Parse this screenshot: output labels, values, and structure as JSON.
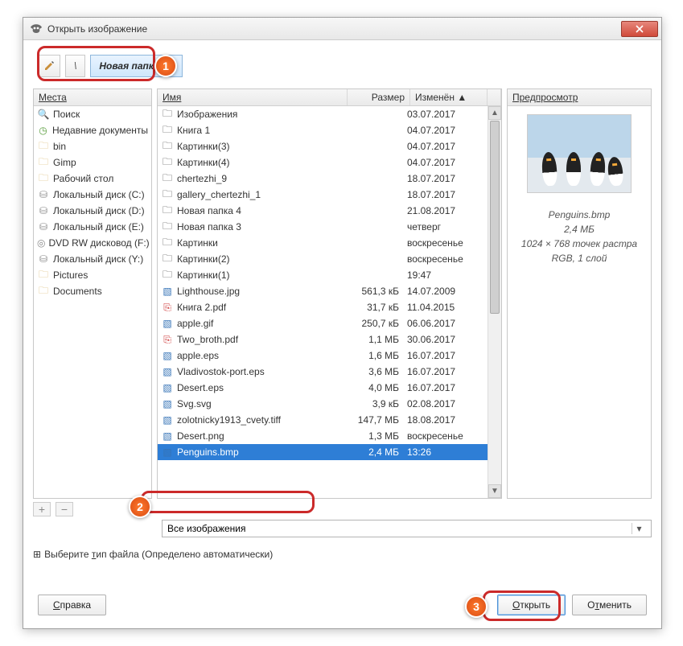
{
  "window": {
    "title": "Открыть изображение"
  },
  "path": {
    "root_label": "\\",
    "folder_label": "Новая папка (2)"
  },
  "places": {
    "header": "Места",
    "items": [
      {
        "label": "Поиск",
        "icon": "search-icon"
      },
      {
        "label": "Недавние документы",
        "icon": "clock-icon"
      },
      {
        "label": "bin",
        "icon": "folder-icon"
      },
      {
        "label": "Gimp",
        "icon": "folder-icon"
      },
      {
        "label": "Рабочий стол",
        "icon": "folder-icon"
      },
      {
        "label": "Локальный диск (C:)",
        "icon": "drive-icon"
      },
      {
        "label": "Локальный диск (D:)",
        "icon": "drive-icon"
      },
      {
        "label": "Локальный диск (E:)",
        "icon": "drive-icon"
      },
      {
        "label": "DVD RW дисковод (F:)",
        "icon": "dvd-icon"
      },
      {
        "label": "Локальный диск (Y:)",
        "icon": "drive-icon"
      },
      {
        "label": "Pictures",
        "icon": "folder-icon"
      },
      {
        "label": "Documents",
        "icon": "folder-icon"
      }
    ]
  },
  "files": {
    "header_name": "Имя",
    "header_size": "Размер",
    "header_modified": "Изменён",
    "rows": [
      {
        "name": "Изображения",
        "size": "",
        "mod": "03.07.2017",
        "icon": "folder"
      },
      {
        "name": "Книга 1",
        "size": "",
        "mod": "04.07.2017",
        "icon": "folder"
      },
      {
        "name": "Картинки(3)",
        "size": "",
        "mod": "04.07.2017",
        "icon": "folder"
      },
      {
        "name": "Картинки(4)",
        "size": "",
        "mod": "04.07.2017",
        "icon": "folder"
      },
      {
        "name": "chertezhi_9",
        "size": "",
        "mod": "18.07.2017",
        "icon": "folder"
      },
      {
        "name": "gallery_chertezhi_1",
        "size": "",
        "mod": "18.07.2017",
        "icon": "folder"
      },
      {
        "name": "Новая папка 4",
        "size": "",
        "mod": "21.08.2017",
        "icon": "folder"
      },
      {
        "name": "Новая папка 3",
        "size": "",
        "mod": "четверг",
        "icon": "folder"
      },
      {
        "name": "Картинки",
        "size": "",
        "mod": "воскресенье",
        "icon": "folder"
      },
      {
        "name": "Картинки(2)",
        "size": "",
        "mod": "воскресенье",
        "icon": "folder"
      },
      {
        "name": "Картинки(1)",
        "size": "",
        "mod": "19:47",
        "icon": "folder"
      },
      {
        "name": "Lighthouse.jpg",
        "size": "561,3 кБ",
        "mod": "14.07.2009",
        "icon": "jpg"
      },
      {
        "name": "Книга 2.pdf",
        "size": "31,7 кБ",
        "mod": "11.04.2015",
        "icon": "pdf"
      },
      {
        "name": "apple.gif",
        "size": "250,7 кБ",
        "mod": "06.06.2017",
        "icon": "gif"
      },
      {
        "name": "Two_broth.pdf",
        "size": "1,1 МБ",
        "mod": "30.06.2017",
        "icon": "pdf"
      },
      {
        "name": "apple.eps",
        "size": "1,6 МБ",
        "mod": "16.07.2017",
        "icon": "eps"
      },
      {
        "name": "Vladivostok-port.eps",
        "size": "3,6 МБ",
        "mod": "16.07.2017",
        "icon": "eps"
      },
      {
        "name": "Desert.eps",
        "size": "4,0 МБ",
        "mod": "16.07.2017",
        "icon": "eps"
      },
      {
        "name": "Svg.svg",
        "size": "3,9 кБ",
        "mod": "02.08.2017",
        "icon": "svg"
      },
      {
        "name": "zolotnicky1913_cvety.tiff",
        "size": "147,7 МБ",
        "mod": "18.08.2017",
        "icon": "tiff"
      },
      {
        "name": "Desert.png",
        "size": "1,3 МБ",
        "mod": "воскресенье",
        "icon": "png"
      },
      {
        "name": "Penguins.bmp",
        "size": "2,4 МБ",
        "mod": "13:26",
        "icon": "bmp",
        "selected": true
      }
    ]
  },
  "preview": {
    "header": "Предпросмотр",
    "filename": "Penguins.bmp",
    "size": "2,4 МБ",
    "dims": "1024 × 768 точек растра",
    "mode": "RGB, 1 слой"
  },
  "filetype": {
    "value": "Все изображения"
  },
  "expand": {
    "label": "Выберите тип файла (Определено автоматически)"
  },
  "buttons": {
    "help": "Справка",
    "open": "Открыть",
    "cancel": "Отменить"
  },
  "badges": {
    "b1": "1",
    "b2": "2",
    "b3": "3"
  }
}
